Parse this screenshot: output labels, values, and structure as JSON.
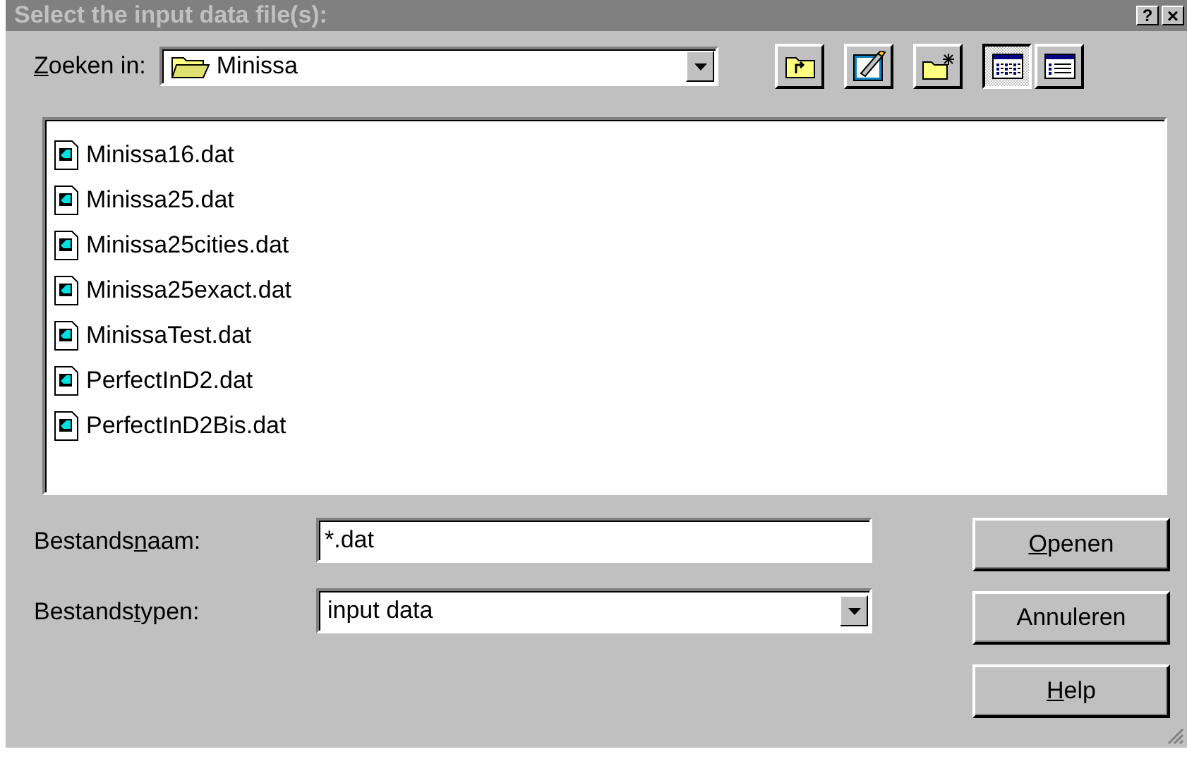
{
  "window": {
    "title": "Select the input data file(s):",
    "buttons": [
      {
        "kind": "help",
        "label": "?"
      },
      {
        "kind": "close",
        "label": "×"
      }
    ]
  },
  "look_in": {
    "label": {
      "key": "Z",
      "after": "oeken in:"
    },
    "value": "Minissa"
  },
  "toolbar": [
    {
      "kind": "up-folder",
      "selected": false
    },
    {
      "kind": "desktop",
      "selected": false
    },
    {
      "kind": "new-folder",
      "selected": false
    },
    {
      "kind": "list-view",
      "selected": true
    },
    {
      "kind": "details-view",
      "selected": false
    }
  ],
  "files": [
    {
      "name": "Minissa16.dat",
      "selected": false
    },
    {
      "name": "Minissa25.dat",
      "selected": false
    },
    {
      "name": "Minissa25cities.dat",
      "selected": false
    },
    {
      "name": "Minissa25exact.dat",
      "selected": false
    },
    {
      "name": "MinissaTest.dat",
      "selected": false
    },
    {
      "name": "PerfectInD2.dat",
      "selected": false
    },
    {
      "name": "PerfectInD2Bis.dat",
      "selected": false
    }
  ],
  "file_name": {
    "label": {
      "before": "Bestands",
      "key": "n",
      "after": "aam:"
    },
    "value": "*.dat"
  },
  "file_type": {
    "label": {
      "before": "Bestands",
      "key": "t",
      "after": "ypen:"
    },
    "value": "input data"
  },
  "buttons": [
    {
      "label": {
        "key": "O",
        "after": "penen"
      }
    },
    {
      "label": {
        "before": "Annuleren"
      }
    },
    {
      "label": {
        "key": "H",
        "after": "elp"
      }
    }
  ]
}
